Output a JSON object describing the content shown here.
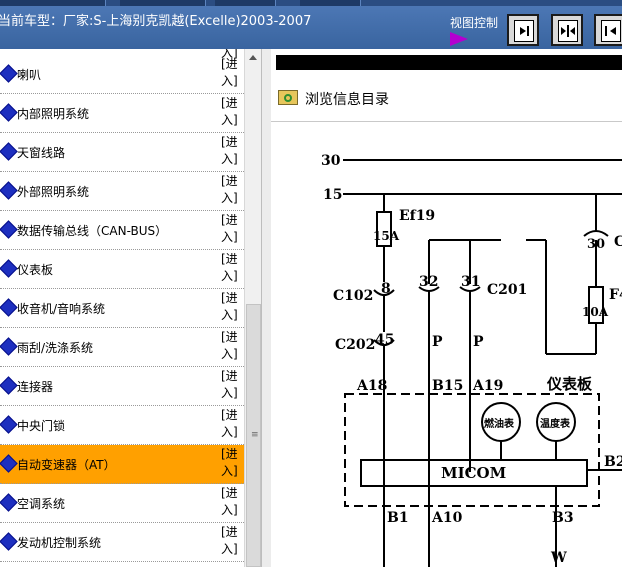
{
  "header": {
    "car_title": "当前车型：厂家:S-上海别克凯越(Excelle)2003-2007",
    "view_control_label": "视图控制",
    "view_buttons": [
      "right-arrow-to-bar",
      "arrows-inward",
      "bar-to-left-arrow"
    ]
  },
  "sidebar": {
    "top_fragment": "入]",
    "enter_label": "[进入]",
    "items": [
      {
        "label": "喇叭",
        "action": "[进\n入]"
      },
      {
        "label": "内部照明系统",
        "action": "[进\n入]"
      },
      {
        "label": "天窗线路",
        "action": "[进\n入]"
      },
      {
        "label": "外部照明系统",
        "action": "[进\n入]"
      },
      {
        "label": "数据传输总线（CAN-BUS）",
        "action": "[进\n入]"
      },
      {
        "label": "仪表板",
        "action": "[进\n入]"
      },
      {
        "label": "收音机/音响系统",
        "action": "[进\n入]"
      },
      {
        "label": "雨刮/洗涤系统",
        "action": "[进\n入]"
      },
      {
        "label": "连接器",
        "action": "[进\n入]"
      },
      {
        "label": "中央门锁",
        "action": "[进\n入]"
      },
      {
        "label": "自动变速器（AT）",
        "action": "[进\n入]",
        "selected": true
      },
      {
        "label": "空调系统",
        "action": "[进\n入]"
      },
      {
        "label": "发动机控制系统",
        "action": "[进\n入]"
      }
    ]
  },
  "content": {
    "browse_label": "浏览信息目录",
    "diagram": {
      "rail_30": "30",
      "rail_15": "15",
      "fuse_ef19": "Ef19",
      "fuse_15a": "15A",
      "conn_30": "30",
      "c_right": "C",
      "fuse_f4": "F4",
      "fuse_10a": "10A",
      "c102": "C102",
      "pin_8": "8",
      "pin_32": "32",
      "pin_31": "31",
      "c201": "C201",
      "c202": "C202",
      "pin_45": "45",
      "wire_p1": "P",
      "wire_p2": "P",
      "a18": "A18",
      "b15": "B15",
      "a19": "A19",
      "cluster": "仪表板",
      "fuel_gauge": "燃油表",
      "temp_gauge": "温度表",
      "micom": "MICOM",
      "b2": "B2",
      "b1": "B1",
      "a10": "A10",
      "b3": "B3",
      "wire_w": "W"
    }
  },
  "colors": {
    "titlebar": "#4a73b0",
    "selected_row": "#ffa000",
    "bullet": "#1d2fbf",
    "arrow": "#b400d0"
  }
}
